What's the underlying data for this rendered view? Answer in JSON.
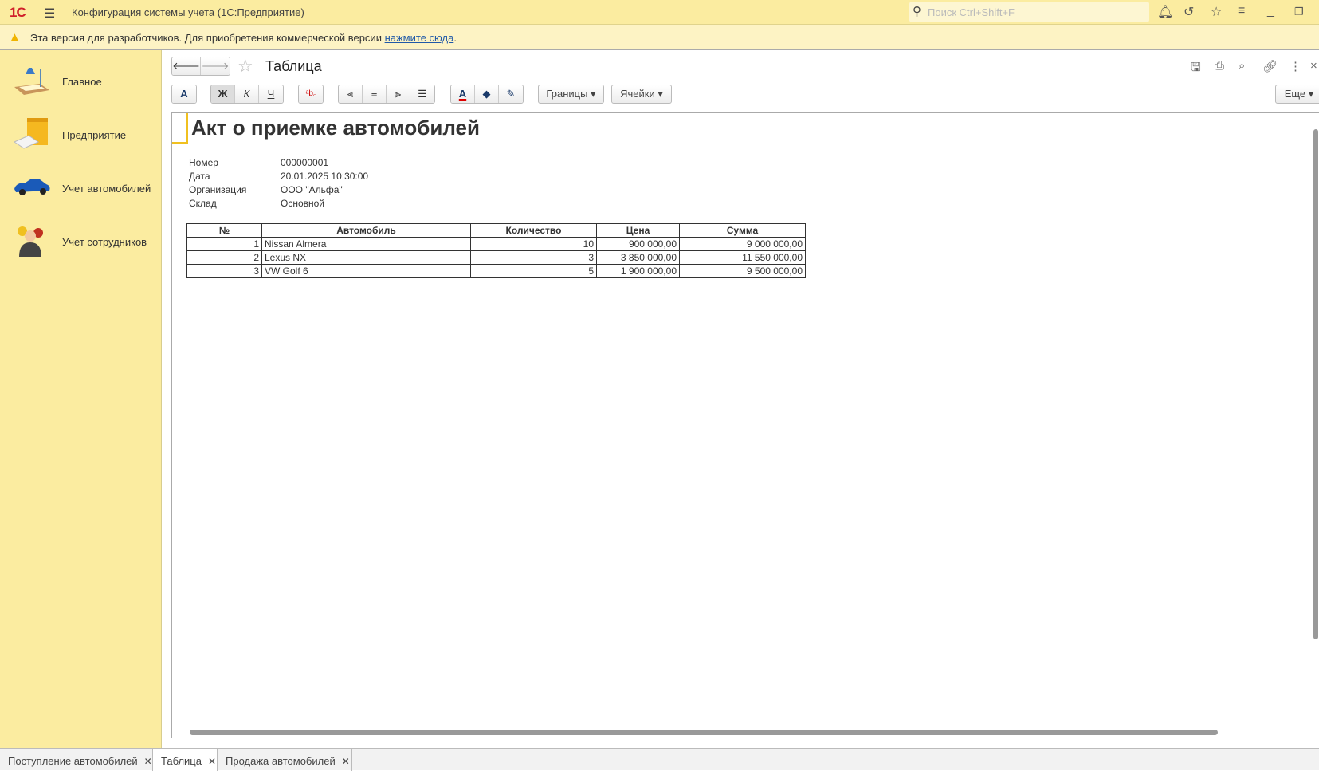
{
  "app": {
    "logo": "1С",
    "title": "Конфигурация системы учета  (1С:Предприятие)",
    "search_placeholder": "Поиск Ctrl+Shift+F"
  },
  "infobar": {
    "text": "Эта версия для разработчиков. Для приобретения коммерческой версии ",
    "link": "нажмите сюда",
    "after": "."
  },
  "sidebar": {
    "items": [
      {
        "label": "Главное",
        "icon": "desk-lamp-icon"
      },
      {
        "label": "Предприятие",
        "icon": "briefcase-icon"
      },
      {
        "label": "Учет автомобилей",
        "icon": "car-icon"
      },
      {
        "label": "Учет сотрудников",
        "icon": "people-icon"
      }
    ]
  },
  "form": {
    "title": "Таблица",
    "borders_label": "Границы",
    "cells_label": "Ячейки",
    "more_label": "Еще"
  },
  "document": {
    "heading": "Акт о приемке автомобилей",
    "fields": [
      {
        "label": "Номер",
        "value": "000000001"
      },
      {
        "label": "Дата",
        "value": "20.01.2025 10:30:00"
      },
      {
        "label": "Организация",
        "value": "ООО \"Альфа\""
      },
      {
        "label": "Склад",
        "value": "Основной"
      }
    ],
    "columns": [
      "№",
      "Автомобиль",
      "Количество",
      "Цена",
      "Сумма"
    ],
    "rows": [
      [
        "1",
        "Nissan Almera",
        "10",
        "900 000,00",
        "9 000 000,00"
      ],
      [
        "2",
        "Lexus NX",
        "3",
        "3 850 000,00",
        "11 550 000,00"
      ],
      [
        "3",
        "VW Golf 6",
        "5",
        "1 900 000,00",
        "9 500 000,00"
      ]
    ]
  },
  "tabs": [
    {
      "label": "Поступление автомобилей",
      "active": false
    },
    {
      "label": "Таблица",
      "active": true
    },
    {
      "label": "Продажа автомобилей",
      "active": false
    }
  ],
  "colors": {
    "accent": "#fbeca0",
    "logo": "#d0202a",
    "link": "#2059a8"
  }
}
